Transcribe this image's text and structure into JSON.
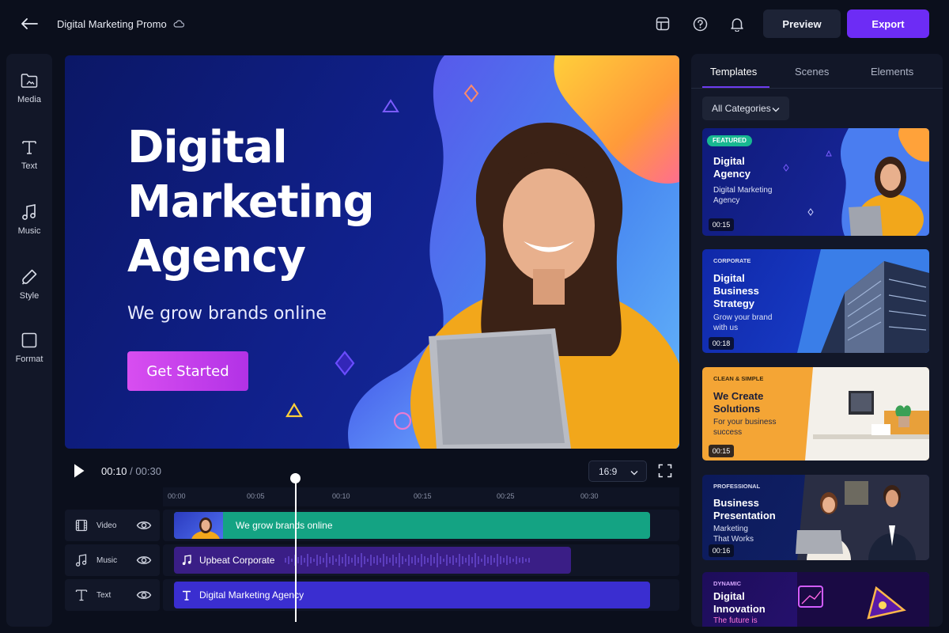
{
  "header": {
    "project_title": "Digital Marketing Promo",
    "back_icon": "arrow-left-icon",
    "cloud_icon": "cloud-icon",
    "icons": [
      "layout-icon",
      "help-icon",
      "bell-icon"
    ],
    "preview_label": "Preview",
    "export_label": "Export"
  },
  "sidebar": {
    "items": [
      {
        "label": "Media",
        "icon": "folder-icon"
      },
      {
        "label": "Text",
        "icon": "text-icon"
      },
      {
        "label": "Music",
        "icon": "music-icon"
      },
      {
        "label": "Style",
        "icon": "palette-icon"
      },
      {
        "label": "Format",
        "icon": "frame-icon"
      }
    ]
  },
  "canvas": {
    "title": "Digital\nMarketing\nAgency",
    "subtitle": "We grow brands online",
    "cta_label": "Get Started"
  },
  "playback": {
    "current_time": "00:10",
    "separator": "/",
    "total_time": "00:30",
    "aspect_ratio": "16:9",
    "playhead_progress": 0.333
  },
  "timeline": {
    "ruler": [
      "00:00",
      "00:05",
      "00:10",
      "00:15",
      "00:25",
      "00:30"
    ],
    "tracks": [
      {
        "name": "Video",
        "icon": "film-icon",
        "clip": "We grow brands online"
      },
      {
        "name": "Music",
        "icon": "music-icon",
        "clip": "Upbeat Corporate"
      },
      {
        "name": "Text",
        "icon": "text-icon",
        "clip": "Digital Marketing Agency"
      }
    ]
  },
  "panel": {
    "tabs": [
      "Templates",
      "Scenes",
      "Elements"
    ],
    "active_tab": "Templates",
    "category": "All Categories",
    "templates": [
      {
        "tag": "FEATURED",
        "title": "Digital\nAgency",
        "subtitle": "Digital Marketing\nAgency",
        "duration": "00:15"
      },
      {
        "tag": "CORPORATE",
        "title": "Digital\nBusiness\nStrategy",
        "subtitle": "Grow your brand\nwith us",
        "duration": "00:18"
      },
      {
        "tag": "CLEAN & SIMPLE",
        "title": "We Create\nSolutions",
        "subtitle": "For your business\nsuccess",
        "duration": "00:15"
      },
      {
        "tag": "PROFESSIONAL",
        "title": "Business\nPresentation",
        "subtitle": "Marketing\nThat Works",
        "duration": "00:16"
      },
      {
        "tag": "DYNAMIC",
        "title": "Digital\nInnovation",
        "subtitle": "The future is\ndigital",
        "duration": ""
      }
    ]
  },
  "colors": {
    "accent": "#6d2cf5",
    "cta_gradient_start": "#d84ef0",
    "video_clip": "#14a383",
    "music_clip": "#3a1e86",
    "text_clip": "#3a2ed0",
    "featured_badge": "#18b891"
  }
}
